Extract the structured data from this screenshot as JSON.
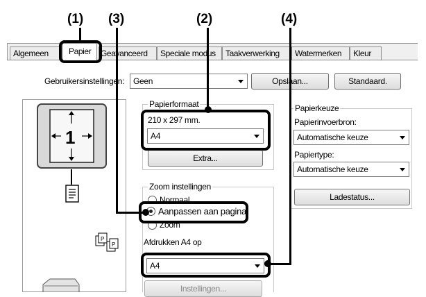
{
  "callouts": [
    "(1)",
    "(3)",
    "(2)",
    "(4)"
  ],
  "tabs": [
    "Algemeen",
    "Papier",
    "Geavanceerd",
    "Speciale modus",
    "Taakverwerking",
    "Watermerken",
    "Kleur"
  ],
  "user_settings": {
    "label": "Gebruikersinstellingen:",
    "value": "Geen",
    "save_button": "Opslaan...",
    "default_button": "Standaard."
  },
  "preview": {
    "page_number": "1",
    "icon_names": [
      "portrait-page-icon",
      "document-icon",
      "collate-copies-icon",
      "scanner-icon"
    ]
  },
  "paper_format": {
    "group_label": "Papierformaat",
    "size_text": "210 x 297 mm.",
    "selected": "A4",
    "extra_button": "Extra..."
  },
  "zoom": {
    "group_label": "Zoom instellingen",
    "options": [
      "Normaal",
      "Aanpassen aan pagina",
      "Zoom"
    ],
    "selected": "Aanpassen aan pagina",
    "print_on_label": "Afdrukken A4 op",
    "print_on_value": "A4",
    "settings_button": "Instellingen..."
  },
  "paper_choice": {
    "group_label": "Papierkeuze",
    "source_label": "Papierinvoerbron:",
    "source_value": "Automatische keuze",
    "type_label": "Papiertype:",
    "type_value": "Automatische keuze",
    "tray_status_button": "Ladestatus..."
  }
}
